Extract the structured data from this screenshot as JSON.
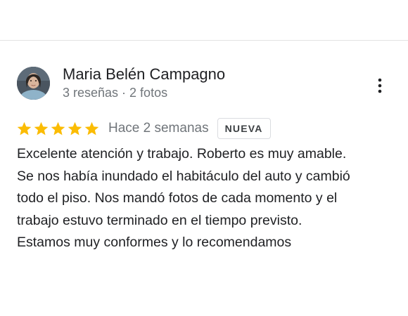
{
  "reviewer": {
    "name": "Maria Belén Campagno",
    "meta": "3 reseñas · 2 fotos",
    "avatar_icon": "reviewer-avatar-photo"
  },
  "menu": {
    "icon": "more-vert-icon"
  },
  "rating": {
    "stars": 5,
    "max": 5,
    "star_color": "#fbbc04",
    "time_ago": "Hace 2 semanas",
    "badge": "NUEVA"
  },
  "review": {
    "lines": [
      "Excelente atención y trabajo. Roberto es muy amable.",
      "Se nos había inundado el habitáculo del auto y cambió",
      "todo el piso. Nos mandó fotos de cada momento y el",
      "trabajo estuvo terminado en el tiempo previsto.",
      "Estamos muy conformes y lo recomendamos"
    ]
  }
}
